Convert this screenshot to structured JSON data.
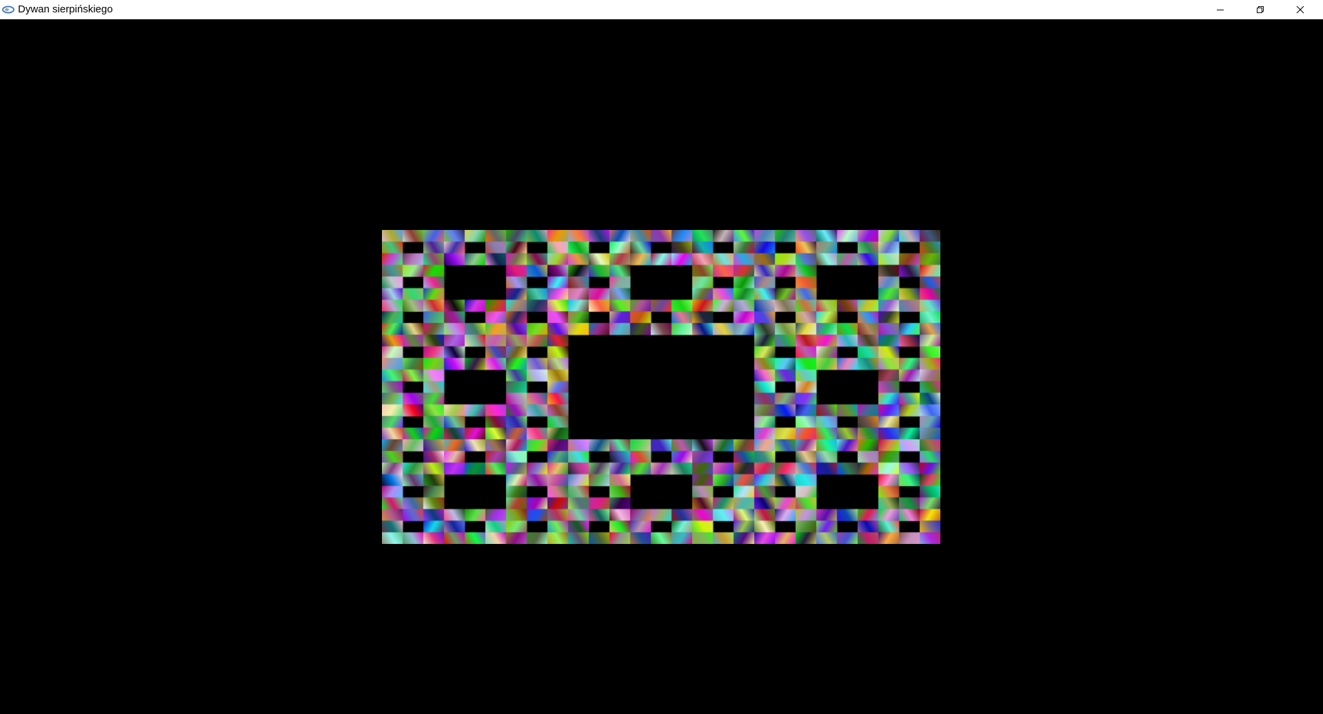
{
  "window": {
    "title": "Dywan sierpińskiego",
    "app_icon": "opengl-app-icon",
    "controls": {
      "minimize_icon": "minimize-icon",
      "maximize_icon": "restore-icon",
      "close_icon": "close-icon"
    }
  },
  "canvas": {
    "background_color": "#000000",
    "fractal": "sierpinski-carpet",
    "cells_per_side": 27
  }
}
